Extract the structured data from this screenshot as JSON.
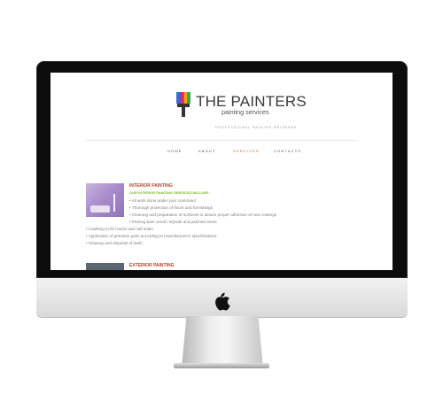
{
  "site": {
    "brand_name": "THE PAINTERS",
    "brand_sub": "painting services",
    "tagline": "PROFESSIONAL PAINTER BRISBANE",
    "nav": [
      {
        "label": "HOME",
        "active": false
      },
      {
        "label": "ABOUT",
        "active": false
      },
      {
        "label": "SERVICES",
        "active": true
      },
      {
        "label": "CONTACTS",
        "active": false
      }
    ],
    "sections": [
      {
        "title": "INTERIOR PAINTING",
        "subtitle": "OUR INTERIOR PAINTING SERVICES INCLUDE:",
        "items": [
          "All work done under your command",
          "Thorough protection of floors and furnishings",
          "Cleaning and preparation of surfaces to assure proper adhesion of new coatings",
          "Priming bare wood / drywall and patched areas",
          "Caulking to fill cracks and nail holes",
          "Application of premium paint according to manufacturer's specifications.",
          "Cleanup and disposal of trash."
        ]
      },
      {
        "title": "EXTERIOR PAINTING"
      }
    ]
  },
  "colors": {
    "accent": "#e05a3a",
    "section_title": "#b5452a",
    "section_sub": "#7fb82a",
    "bezel": "#0c0c0c"
  },
  "icons": [
    "paint-brush-logo-icon",
    "apple-logo-icon"
  ]
}
